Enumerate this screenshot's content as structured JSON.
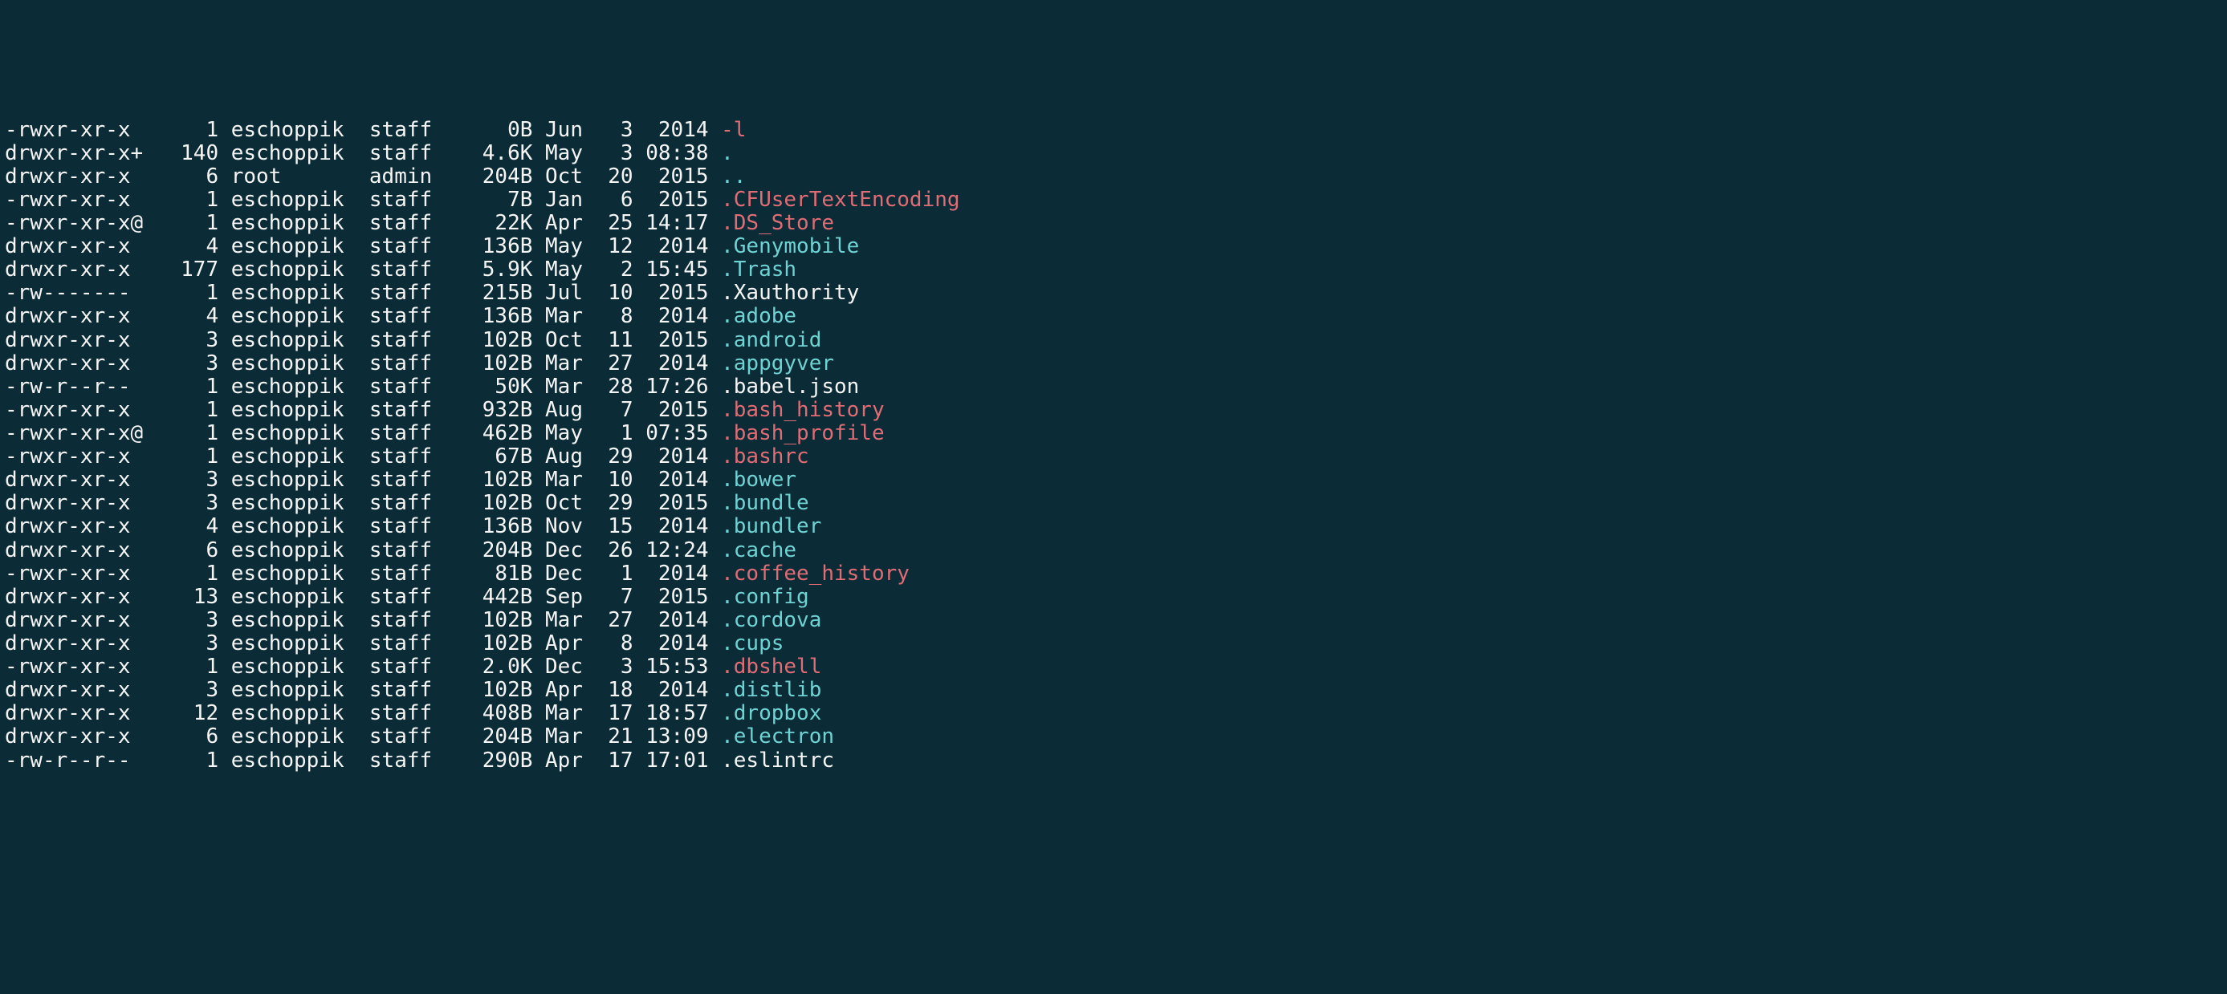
{
  "listing": [
    {
      "perm": "-rwxr-xr-x",
      "links": "1",
      "user": "eschoppik",
      "group": "staff",
      "size": "0B",
      "mon": "Jun",
      "day": "3",
      "time": "2014",
      "name": "-l",
      "color": "red"
    },
    {
      "perm": "drwxr-xr-x+",
      "links": "140",
      "user": "eschoppik",
      "group": "staff",
      "size": "4.6K",
      "mon": "May",
      "day": "3",
      "time": "08:38",
      "name": ".",
      "color": "cyan"
    },
    {
      "perm": "drwxr-xr-x",
      "links": "6",
      "user": "root",
      "group": "admin",
      "size": "204B",
      "mon": "Oct",
      "day": "20",
      "time": "2015",
      "name": "..",
      "color": "cyan"
    },
    {
      "perm": "-rwxr-xr-x",
      "links": "1",
      "user": "eschoppik",
      "group": "staff",
      "size": "7B",
      "mon": "Jan",
      "day": "6",
      "time": "2015",
      "name": ".CFUserTextEncoding",
      "color": "red"
    },
    {
      "perm": "-rwxr-xr-x@",
      "links": "1",
      "user": "eschoppik",
      "group": "staff",
      "size": "22K",
      "mon": "Apr",
      "day": "25",
      "time": "14:17",
      "name": ".DS_Store",
      "color": "red"
    },
    {
      "perm": "drwxr-xr-x",
      "links": "4",
      "user": "eschoppik",
      "group": "staff",
      "size": "136B",
      "mon": "May",
      "day": "12",
      "time": "2014",
      "name": ".Genymobile",
      "color": "cyan"
    },
    {
      "perm": "drwxr-xr-x",
      "links": "177",
      "user": "eschoppik",
      "group": "staff",
      "size": "5.9K",
      "mon": "May",
      "day": "2",
      "time": "15:45",
      "name": ".Trash",
      "color": "cyan"
    },
    {
      "perm": "-rw-------",
      "links": "1",
      "user": "eschoppik",
      "group": "staff",
      "size": "215B",
      "mon": "Jul",
      "day": "10",
      "time": "2015",
      "name": ".Xauthority",
      "color": "white"
    },
    {
      "perm": "drwxr-xr-x",
      "links": "4",
      "user": "eschoppik",
      "group": "staff",
      "size": "136B",
      "mon": "Mar",
      "day": "8",
      "time": "2014",
      "name": ".adobe",
      "color": "cyan"
    },
    {
      "perm": "drwxr-xr-x",
      "links": "3",
      "user": "eschoppik",
      "group": "staff",
      "size": "102B",
      "mon": "Oct",
      "day": "11",
      "time": "2015",
      "name": ".android",
      "color": "cyan"
    },
    {
      "perm": "drwxr-xr-x",
      "links": "3",
      "user": "eschoppik",
      "group": "staff",
      "size": "102B",
      "mon": "Mar",
      "day": "27",
      "time": "2014",
      "name": ".appgyver",
      "color": "cyan"
    },
    {
      "perm": "-rw-r--r--",
      "links": "1",
      "user": "eschoppik",
      "group": "staff",
      "size": "50K",
      "mon": "Mar",
      "day": "28",
      "time": "17:26",
      "name": ".babel.json",
      "color": "white"
    },
    {
      "perm": "-rwxr-xr-x",
      "links": "1",
      "user": "eschoppik",
      "group": "staff",
      "size": "932B",
      "mon": "Aug",
      "day": "7",
      "time": "2015",
      "name": ".bash_history",
      "color": "red"
    },
    {
      "perm": "-rwxr-xr-x@",
      "links": "1",
      "user": "eschoppik",
      "group": "staff",
      "size": "462B",
      "mon": "May",
      "day": "1",
      "time": "07:35",
      "name": ".bash_profile",
      "color": "red"
    },
    {
      "perm": "-rwxr-xr-x",
      "links": "1",
      "user": "eschoppik",
      "group": "staff",
      "size": "67B",
      "mon": "Aug",
      "day": "29",
      "time": "2014",
      "name": ".bashrc",
      "color": "red"
    },
    {
      "perm": "drwxr-xr-x",
      "links": "3",
      "user": "eschoppik",
      "group": "staff",
      "size": "102B",
      "mon": "Mar",
      "day": "10",
      "time": "2014",
      "name": ".bower",
      "color": "cyan"
    },
    {
      "perm": "drwxr-xr-x",
      "links": "3",
      "user": "eschoppik",
      "group": "staff",
      "size": "102B",
      "mon": "Oct",
      "day": "29",
      "time": "2015",
      "name": ".bundle",
      "color": "cyan"
    },
    {
      "perm": "drwxr-xr-x",
      "links": "4",
      "user": "eschoppik",
      "group": "staff",
      "size": "136B",
      "mon": "Nov",
      "day": "15",
      "time": "2014",
      "name": ".bundler",
      "color": "cyan"
    },
    {
      "perm": "drwxr-xr-x",
      "links": "6",
      "user": "eschoppik",
      "group": "staff",
      "size": "204B",
      "mon": "Dec",
      "day": "26",
      "time": "12:24",
      "name": ".cache",
      "color": "cyan"
    },
    {
      "perm": "-rwxr-xr-x",
      "links": "1",
      "user": "eschoppik",
      "group": "staff",
      "size": "81B",
      "mon": "Dec",
      "day": "1",
      "time": "2014",
      "name": ".coffee_history",
      "color": "red"
    },
    {
      "perm": "drwxr-xr-x",
      "links": "13",
      "user": "eschoppik",
      "group": "staff",
      "size": "442B",
      "mon": "Sep",
      "day": "7",
      "time": "2015",
      "name": ".config",
      "color": "cyan"
    },
    {
      "perm": "drwxr-xr-x",
      "links": "3",
      "user": "eschoppik",
      "group": "staff",
      "size": "102B",
      "mon": "Mar",
      "day": "27",
      "time": "2014",
      "name": ".cordova",
      "color": "cyan"
    },
    {
      "perm": "drwxr-xr-x",
      "links": "3",
      "user": "eschoppik",
      "group": "staff",
      "size": "102B",
      "mon": "Apr",
      "day": "8",
      "time": "2014",
      "name": ".cups",
      "color": "cyan"
    },
    {
      "perm": "-rwxr-xr-x",
      "links": "1",
      "user": "eschoppik",
      "group": "staff",
      "size": "2.0K",
      "mon": "Dec",
      "day": "3",
      "time": "15:53",
      "name": ".dbshell",
      "color": "red"
    },
    {
      "perm": "drwxr-xr-x",
      "links": "3",
      "user": "eschoppik",
      "group": "staff",
      "size": "102B",
      "mon": "Apr",
      "day": "18",
      "time": "2014",
      "name": ".distlib",
      "color": "cyan"
    },
    {
      "perm": "drwxr-xr-x",
      "links": "12",
      "user": "eschoppik",
      "group": "staff",
      "size": "408B",
      "mon": "Mar",
      "day": "17",
      "time": "18:57",
      "name": ".dropbox",
      "color": "cyan"
    },
    {
      "perm": "drwxr-xr-x",
      "links": "6",
      "user": "eschoppik",
      "group": "staff",
      "size": "204B",
      "mon": "Mar",
      "day": "21",
      "time": "13:09",
      "name": ".electron",
      "color": "cyan"
    },
    {
      "perm": "-rw-r--r--",
      "links": "1",
      "user": "eschoppik",
      "group": "staff",
      "size": "290B",
      "mon": "Apr",
      "day": "17",
      "time": "17:01",
      "name": ".eslintrc",
      "color": "white"
    }
  ]
}
